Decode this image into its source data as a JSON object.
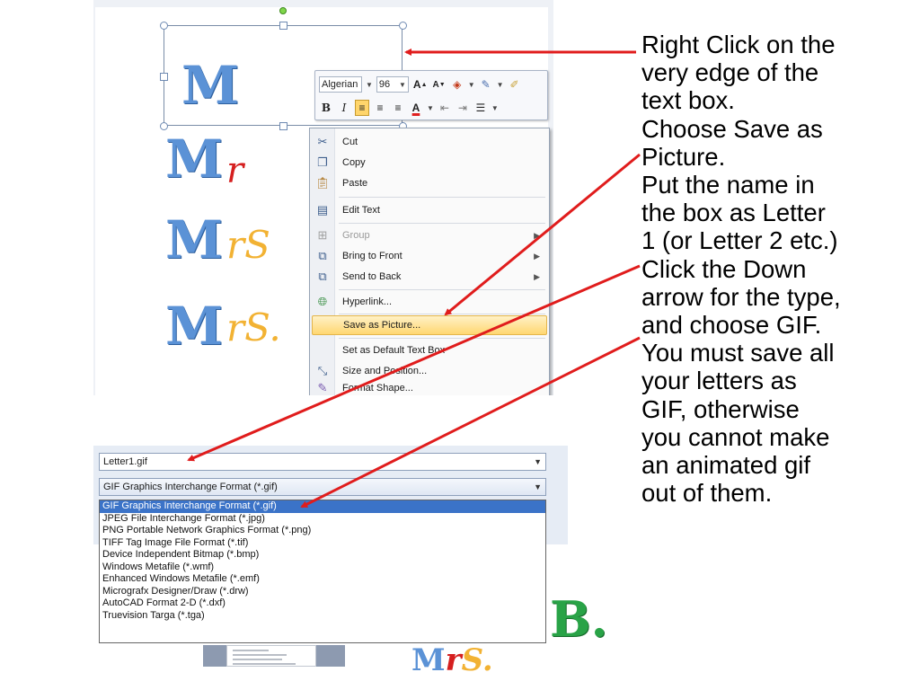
{
  "instructions": [
    "Right Click on the",
    "very edge of the",
    "text box.",
    "Choose Save as",
    "Picture.",
    "Put the name in",
    "the box as Letter",
    "1 (or Letter 2 etc.)",
    "Click the Down",
    "arrow for the type,",
    "and choose GIF.",
    "You must save all",
    "your letters as",
    "GIF, otherwise",
    "you cannot make",
    "an animated gif",
    "out of them."
  ],
  "canvas": {
    "letter_m": "M",
    "deco_r": "r",
    "deco_rs": "rS",
    "deco_rs_dot": "rS."
  },
  "mini_toolbar": {
    "font_name": "Algerian",
    "font_size": "96",
    "grow_font": "A",
    "shrink_font": "A",
    "bold": "B",
    "italic": "I",
    "font_color_letter": "A"
  },
  "context_menu": {
    "cut": "Cut",
    "copy": "Copy",
    "paste": "Paste",
    "edit_text": "Edit Text",
    "group": "Group",
    "bring_to_front": "Bring to Front",
    "send_to_back": "Send to Back",
    "hyperlink": "Hyperlink...",
    "save_as_picture": "Save as Picture...",
    "set_default": "Set as Default Text Box",
    "size_position": "Size and Position...",
    "format_shape": "Format Shape..."
  },
  "save_dialog": {
    "filename": "Letter1.gif",
    "selected_type": "GIF Graphics Interchange Format (*.gif)",
    "type_options": [
      "GIF Graphics Interchange Format (*.gif)",
      "JPEG File Interchange Format (*.jpg)",
      "PNG Portable Network Graphics Format (*.png)",
      "TIFF Tag Image File Format (*.tif)",
      "Device Independent Bitmap (*.bmp)",
      "Windows Metafile (*.wmf)",
      "Enhanced Windows Metafile (*.emf)",
      "Micrografx Designer/Draw (*.drw)",
      "AutoCAD Format 2-D (*.dxf)",
      "Truevision Targa (*.tga)"
    ]
  },
  "bottom_letters": {
    "letter_b": "B.",
    "partial_a": "M",
    "partial_b": "r",
    "partial_c": "S."
  },
  "colors": {
    "arrow": "#e01c1c",
    "letter_blue": "#5b92d6",
    "letter_red": "#d51f1f",
    "letter_gold": "#f2b233",
    "letter_green": "#29a347",
    "selection_blue": "#3b73c8",
    "menu_highlight": "#ffd771"
  }
}
